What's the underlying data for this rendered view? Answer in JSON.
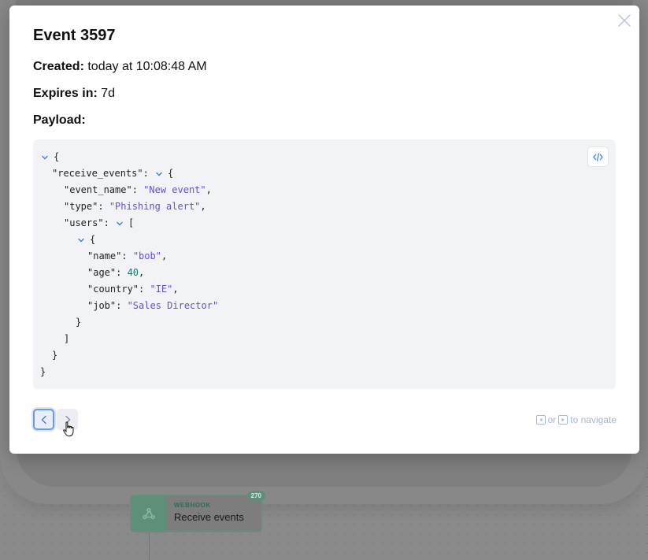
{
  "modal": {
    "title": "Event 3597",
    "created_label": "Created:",
    "created_value": "today at 10:08:48 AM",
    "expires_label": "Expires in:",
    "expires_value": "7d",
    "payload_label": "Payload:"
  },
  "payload": {
    "open_brace": "{",
    "close_brace": "}",
    "receive_events_key": "\"receive_events\"",
    "event_name_key": "\"event_name\"",
    "event_name_value": "\"New event\"",
    "type_key": "\"type\"",
    "type_value": "\"Phishing alert\"",
    "users_key": "\"users\"",
    "open_bracket": "[",
    "close_bracket": "]",
    "name_key": "\"name\"",
    "name_value": "\"bob\"",
    "age_key": "\"age\"",
    "age_value": "40",
    "country_key": "\"country\"",
    "country_value": "\"IE\"",
    "job_key": "\"job\"",
    "job_value": "\"Sales Director\""
  },
  "navigation": {
    "hint_or": "or",
    "hint_text": "to navigate"
  },
  "background": {
    "webhook_type": "WEBHOOK",
    "webhook_title": "Receive events",
    "webhook_count": "270"
  },
  "colors": {
    "string_value": "#6a4fd6",
    "number_value": "#0f7d6b",
    "chevron": "#3b7fd8",
    "focus_ring": "#6c9be0",
    "webhook_accent": "#5e8f78"
  },
  "icons": {
    "close": "close-icon",
    "code_toggle": "code-icon",
    "chevron": "chevron-down-icon",
    "prev": "chevron-left-icon",
    "next": "chevron-right-icon",
    "webhook": "webhook-icon",
    "cursor": "hand-pointer-icon"
  }
}
